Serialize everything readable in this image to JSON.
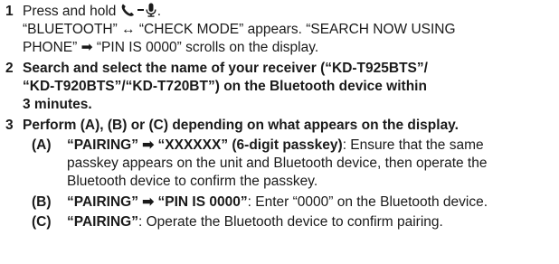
{
  "steps": [
    {
      "number": "1",
      "line1_text": "Press and hold",
      "line1_icons": [
        "phone-icon",
        "minus-icon",
        "microphone-icon"
      ],
      "line1_end": ".",
      "line2": "“BLUETOOTH” ↔ “CHECK MODE” appears. “SEARCH NOW USING",
      "line3": "PHONE” ➡ “PIN IS 0000” scrolls on the display."
    },
    {
      "number": "2",
      "line1": "Search and select the name of your receiver (“KD-T925BTS”/",
      "line2": "“KD-T920BTS”/“KD-T720BT”) on the Bluetooth device within",
      "line3": "3 minutes."
    },
    {
      "number": "3",
      "line1": "Perform (A), (B) or (C) depending on what appears on the display.",
      "substeps": [
        {
          "label": "(A)",
          "bold": "“PAIRING” ➡ “XXXXXX” (6-digit passkey)",
          "text1": ": Ensure that the same",
          "line2": "passkey appears on the unit and Bluetooth device, then operate the",
          "line3": "Bluetooth device to confirm the passkey."
        },
        {
          "label": "(B)",
          "bold": "“PAIRING” ➡ “PIN IS 0000”",
          "text1": ": Enter “0000” on the Bluetooth device."
        },
        {
          "label": "(C)",
          "bold": "“PAIRING”",
          "text1": ": Operate the Bluetooth device to confirm pairing."
        }
      ]
    }
  ]
}
